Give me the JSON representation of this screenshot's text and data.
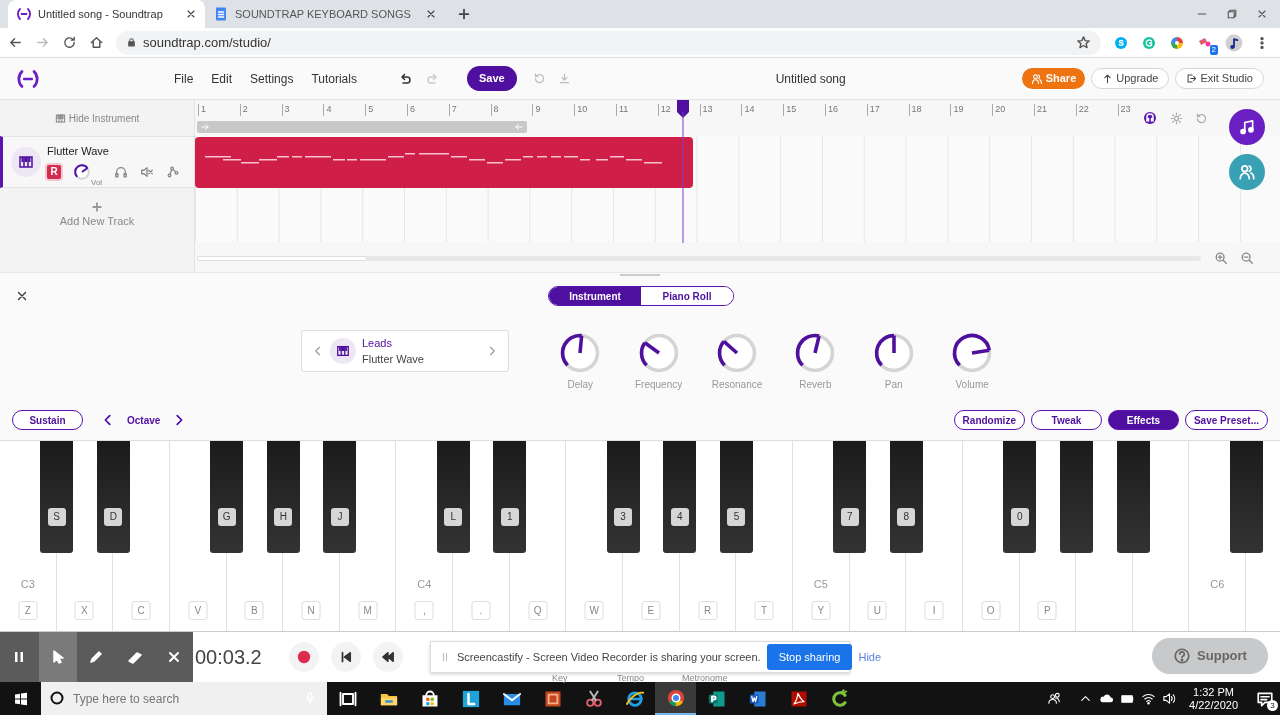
{
  "browser": {
    "tabs": [
      {
        "title": "Untitled song - Soundtrap",
        "selected": true
      },
      {
        "title": "SOUNDTRAP KEYBOARD SONGS",
        "selected": false
      }
    ],
    "url": "soundtrap.com/studio/",
    "extension_badge": "2"
  },
  "studio_header": {
    "menu": [
      "File",
      "Edit",
      "Settings",
      "Tutorials"
    ],
    "save": "Save",
    "song_title": "Untitled song",
    "share": "Share",
    "upgrade": "Upgrade",
    "exit": "Exit Studio"
  },
  "tracks": {
    "hide_instrument": "Hide Instrument",
    "ruler": [
      "1",
      "2",
      "3",
      "4",
      "5",
      "6",
      "7",
      "8",
      "9",
      "10",
      "11",
      "12",
      "13",
      "14",
      "15",
      "16",
      "17",
      "18",
      "19",
      "20",
      "21",
      "22",
      "23"
    ],
    "playhead": {
      "level": 0.45
    },
    "track": {
      "name": "Flutter Wave",
      "record": "R",
      "volume_label": "Vol"
    },
    "add_track": "Add New Track"
  },
  "instrument_panel": {
    "tabs": [
      {
        "label": "Instrument",
        "selected": true
      },
      {
        "label": "Piano Roll",
        "selected": false
      }
    ],
    "preset": {
      "category": "Leads",
      "name": "Flutter Wave"
    },
    "knobs": [
      {
        "label": "Delay"
      },
      {
        "label": "Frequency"
      },
      {
        "label": "Resonance"
      },
      {
        "label": "Reverb"
      },
      {
        "label": "Pan"
      },
      {
        "label": "Volume"
      }
    ],
    "sustain": "Sustain",
    "octave": "Octave",
    "buttons": [
      {
        "label": "Randomize",
        "selected": false
      },
      {
        "label": "Tweak",
        "selected": false
      },
      {
        "label": "Effects",
        "selected": true
      },
      {
        "label": "Save Preset...",
        "selected": false
      }
    ]
  },
  "keyboard": {
    "octave_labels": [
      "C3",
      "C4",
      "C5",
      "C6"
    ],
    "white_keys": [
      "Z",
      "X",
      "C",
      "V",
      "B",
      "N",
      "M",
      ",",
      ".",
      "Q",
      "W",
      "E",
      "R",
      "T",
      "Y",
      "U",
      "I",
      "O",
      "P"
    ],
    "black_keys": [
      "S",
      "D",
      "G",
      "H",
      "J",
      "L",
      "1",
      "3",
      "4",
      "5",
      "7",
      "8",
      "0"
    ]
  },
  "transport": {
    "time": "00:03.2",
    "labels": [
      "Key",
      "Tempo",
      "Metronome"
    ]
  },
  "screencastify": {
    "message": "Screencastify - Screen Video Recorder is sharing your screen.",
    "stop": "Stop sharing",
    "hide": "Hide"
  },
  "support": "Support",
  "taskbar": {
    "search_placeholder": "Type here to search",
    "time": "1:32 PM",
    "date": "4/22/2020",
    "notifications": "3"
  }
}
